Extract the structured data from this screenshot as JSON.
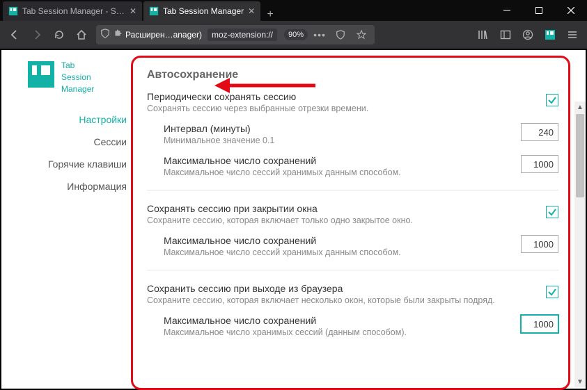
{
  "browser": {
    "tabs": [
      {
        "label": "Tab Session Manager - Sess",
        "active": false
      },
      {
        "label": "Tab Session Manager",
        "active": true
      }
    ],
    "url_segment1": "Расширен…anager)",
    "url_segment2": "moz-extension://",
    "zoom": "90%"
  },
  "app": {
    "title_line1": "Tab",
    "title_line2": "Session",
    "title_line3": "Manager",
    "nav": {
      "settings": "Настройки",
      "sessions": "Сессии",
      "hotkeys": "Горячие клавиши",
      "info": "Информация"
    }
  },
  "settings": {
    "section_title": "Автосохранение",
    "periodic": {
      "title": "Периодически сохранять сессию",
      "desc": "Сохранять сессию через выбранные отрезки времени.",
      "checked": true,
      "interval": {
        "title": "Интервал (минуты)",
        "desc": "Минимальное значение 0.1",
        "value": "240"
      },
      "max": {
        "title": "Максимальное число сохранений",
        "desc": "Максимальное число сессий хранимых данным способом.",
        "value": "1000"
      }
    },
    "on_window_close": {
      "title": "Сохранять сессию при закрытии окна",
      "desc": "Сохраните сессию, которая включает только одно закрытое окно.",
      "checked": true,
      "max": {
        "title": "Максимальное число сохранений",
        "desc": "Максимальное число сессий хранимых данным способом.",
        "value": "1000"
      }
    },
    "on_browser_exit": {
      "title": "Сохранить сессию при выходе из браузера",
      "desc": "Сохраните сессию, которая включает несколько окон, которые были закрыты подряд.",
      "checked": true,
      "max": {
        "title": "Максимальное число сохранений",
        "desc": "Максимальное число хранимых сессий (данным способом).",
        "value": "1000"
      }
    }
  },
  "colors": {
    "accent": "#12b2a6",
    "callout": "#e20a17"
  }
}
